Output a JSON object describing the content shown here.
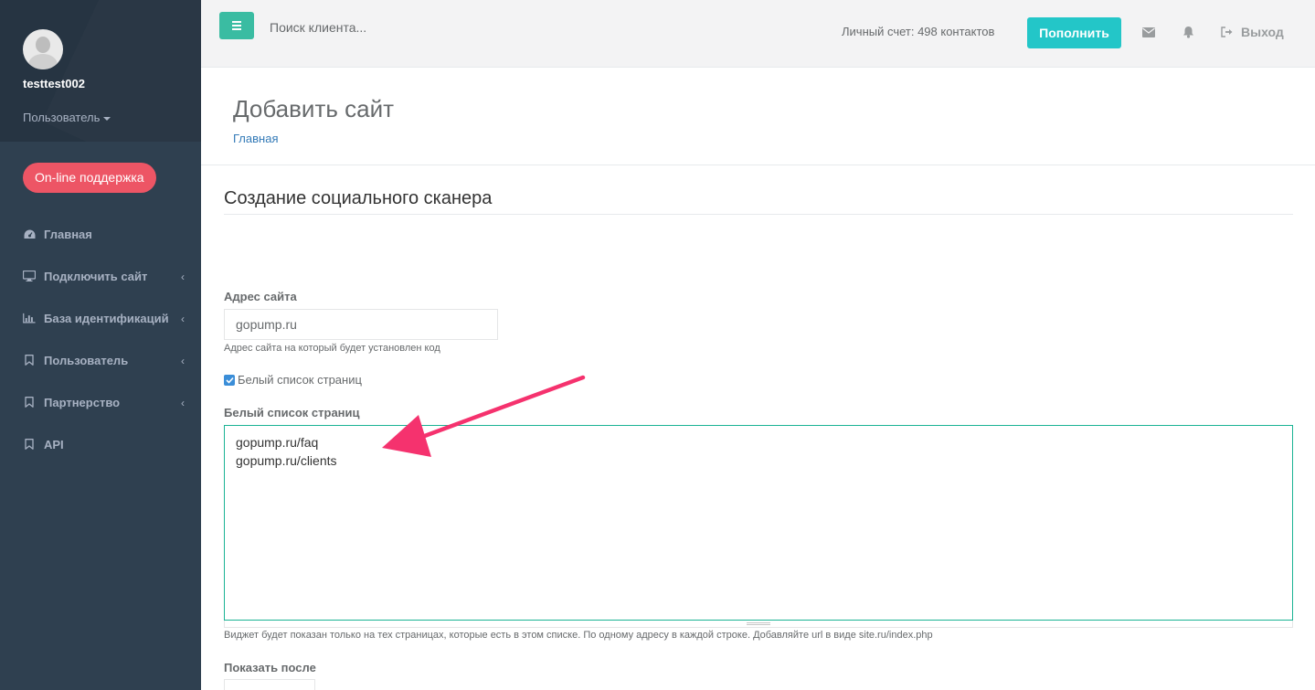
{
  "sidebar": {
    "username": "testtest002",
    "role": "Пользователь",
    "support_button": "On-line поддержка",
    "items": [
      {
        "label": "Главная",
        "icon": "dashboard-icon",
        "has_submenu": false
      },
      {
        "label": "Подключить сайт",
        "icon": "desktop-icon",
        "has_submenu": true
      },
      {
        "label": "База идентификаций",
        "icon": "bar-chart-icon",
        "has_submenu": true
      },
      {
        "label": "Пользователь",
        "icon": "bookmark-icon",
        "has_submenu": true
      },
      {
        "label": "Партнерство",
        "icon": "bookmark-icon",
        "has_submenu": true
      },
      {
        "label": "API",
        "icon": "bookmark-icon",
        "has_submenu": false
      }
    ]
  },
  "topbar": {
    "search_placeholder": "Поиск клиента...",
    "account": "Личный счет: 498 контактов",
    "topup_button": "Пополнить",
    "logout": "Выход"
  },
  "heading": {
    "title": "Добавить сайт",
    "breadcrumb": "Главная"
  },
  "form": {
    "section_title": "Создание социального сканера",
    "site_address_label": "Адрес сайта",
    "site_address_value": "gopump.ru",
    "site_address_help": "Адрес сайта на который будет установлен код",
    "whitelist_checkbox_label": "Белый список страниц",
    "whitelist_checked": true,
    "whitelist_label": "Белый список страниц",
    "whitelist_value": "gopump.ru/faq\ngopump.ru/clients",
    "whitelist_help": "Виджет будет показан только на тех страницах, которые есть в этом списке. По одному адресу в каждой строке. Добавляйте url в виде site.ru/index.php",
    "show_after_label": "Показать после"
  },
  "colors": {
    "sidebar_bg": "#2f4050",
    "accent_green": "#1ab394",
    "topup_cyan": "#23c6c8",
    "support_red": "#ed5565",
    "annotation_arrow": "#f5326e"
  }
}
